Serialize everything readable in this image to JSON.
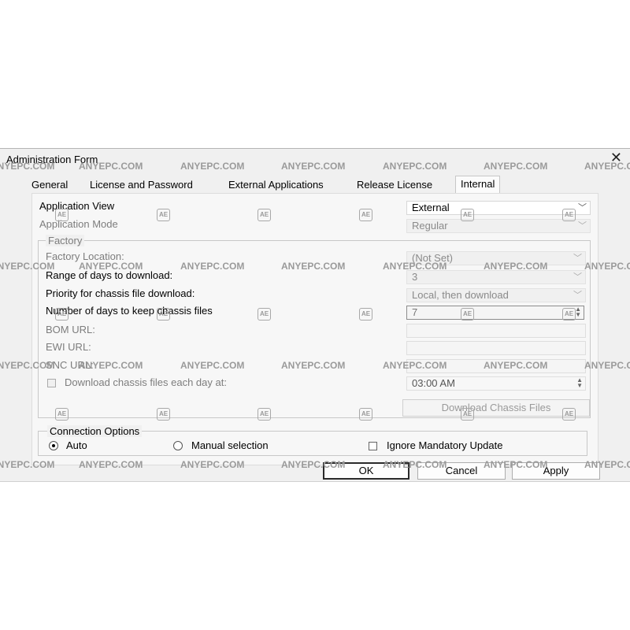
{
  "window": {
    "title": "Administration Form"
  },
  "tabs": [
    {
      "label": "General"
    },
    {
      "label": "License and Password"
    },
    {
      "label": "External Applications"
    },
    {
      "label": "Release License"
    },
    {
      "label": "Internal"
    }
  ],
  "internal": {
    "application_view": {
      "label": "Application View",
      "value": "External"
    },
    "application_mode": {
      "label": "Application Mode",
      "value": "Regular"
    },
    "factory_group": {
      "title": "Factory",
      "factory_location": {
        "label": "Factory Location:",
        "value": "(Not Set)"
      },
      "range_of_days": {
        "label": "Range of days to download:",
        "value": "3"
      },
      "priority": {
        "label": "Priority for chassis file download:",
        "value": "Local, then download"
      },
      "days_to_keep": {
        "label": "Number of days to keep chassis files",
        "value": "7"
      },
      "bom_url": {
        "label": "BOM URL:",
        "value": ""
      },
      "ewi_url": {
        "label": "EWI URL:",
        "value": ""
      },
      "snc_url": {
        "label": "SNC URL:",
        "value": ""
      },
      "download_daily": {
        "label": "Download chassis files each day at:",
        "checked": false,
        "time": "03:00 AM"
      },
      "download_button": "Download Chassis Files"
    },
    "connection_options": {
      "title": "Connection Options",
      "auto": {
        "label": "Auto",
        "selected": true
      },
      "manual": {
        "label": "Manual selection",
        "selected": false
      },
      "ignore_update": {
        "label": "Ignore Mandatory Update",
        "checked": false
      }
    }
  },
  "buttons": {
    "ok": "OK",
    "cancel": "Cancel",
    "apply": "Apply"
  },
  "watermark": {
    "text": "ANYEPC.COM",
    "badge": "AE"
  },
  "icons": {
    "close": "close-icon",
    "dropdown": "chevron-down-icon",
    "spinner": "spinner-arrows-icon"
  }
}
